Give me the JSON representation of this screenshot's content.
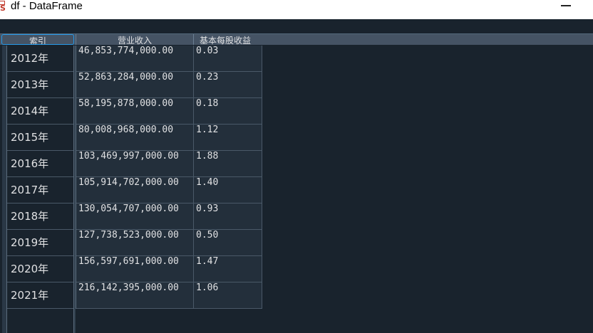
{
  "window": {
    "title": "df - DataFrame"
  },
  "table": {
    "headers": {
      "index": "索引",
      "revenue": "营业收入",
      "eps": "基本每股收益"
    },
    "rows": [
      {
        "index": "2012年",
        "revenue": "46,853,774,000.00",
        "eps": "0.03"
      },
      {
        "index": "2013年",
        "revenue": "52,863,284,000.00",
        "eps": "0.23"
      },
      {
        "index": "2014年",
        "revenue": "58,195,878,000.00",
        "eps": "0.18"
      },
      {
        "index": "2015年",
        "revenue": "80,008,968,000.00",
        "eps": "1.12"
      },
      {
        "index": "2016年",
        "revenue": "103,469,997,000.00",
        "eps": "1.88"
      },
      {
        "index": "2017年",
        "revenue": "105,914,702,000.00",
        "eps": "1.40"
      },
      {
        "index": "2018年",
        "revenue": "130,054,707,000.00",
        "eps": "0.93"
      },
      {
        "index": "2019年",
        "revenue": "127,738,523,000.00",
        "eps": "0.50"
      },
      {
        "index": "2020年",
        "revenue": "156,597,691,000.00",
        "eps": "1.47"
      },
      {
        "index": "2021年",
        "revenue": "216,142,395,000.00",
        "eps": "1.06"
      }
    ]
  },
  "colors": {
    "background": "#19232d",
    "header": "#455364",
    "accent": "#259ae9",
    "text": "#e0e1e3"
  }
}
